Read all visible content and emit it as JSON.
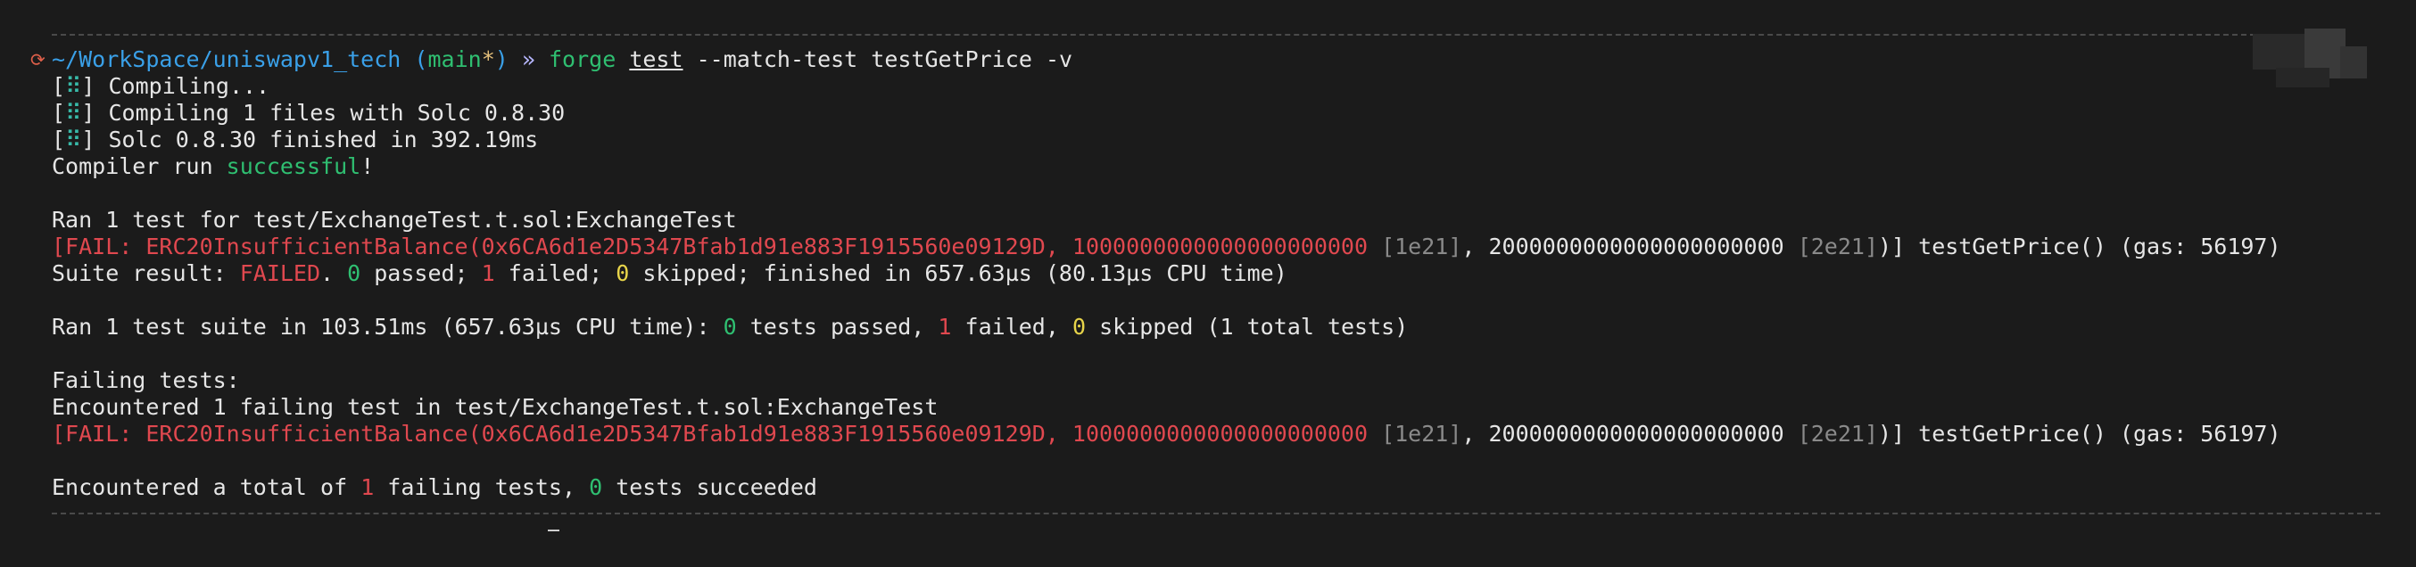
{
  "prompt": {
    "path": "~/WorkSpace/uniswapv1_tech",
    "branch_open": "(",
    "branch": "main",
    "branch_dirty": "*",
    "branch_close": ")",
    "arrow": "»",
    "command": "forge",
    "subcommand": "test",
    "args": "--match-test testGetPrice -v"
  },
  "compile": {
    "spinner": "⠿",
    "lines": [
      "Compiling...",
      "Compiling 1 files with Solc 0.8.30",
      "Solc 0.8.30 finished in 392.19ms"
    ],
    "run_prefix": "Compiler run ",
    "run_status": "successful",
    "run_suffix": "!"
  },
  "suite": {
    "ran": "Ran 1 test for test/ExchangeTest.t.sol:ExchangeTest",
    "fail_prefix": "[FAIL: ERC20InsufficientBalance(0x6CA6d1e2D5347Bfab1d91e883F1915560e09129D, 1000000000000000000000 ",
    "fail_sci1": "[1e21]",
    "fail_mid": ", 2000000000000000000000 ",
    "fail_sci2": "[2e21]",
    "fail_suffix": ")] testGetPrice() (gas: 56197)",
    "result_label": "Suite result: ",
    "result_status": "FAILED",
    "result_sep": ". ",
    "passed_count": "0",
    "passed_label": " passed; ",
    "failed_count": "1",
    "failed_label": " failed; ",
    "skipped_count": "0",
    "skipped_label": " skipped; finished in 657.63µs (80.13µs CPU time)"
  },
  "summary": {
    "prefix": "Ran 1 test suite in 103.51ms (657.63µs CPU time): ",
    "passed_count": "0",
    "passed_label": " tests passed, ",
    "failed_count": "1",
    "failed_label": " failed, ",
    "skipped_count": "0",
    "skipped_label": " skipped (1 total tests)"
  },
  "failing": {
    "header": "Failing tests:",
    "encountered": "Encountered 1 failing test in test/ExchangeTest.t.sol:ExchangeTest"
  },
  "total": {
    "prefix": "Encountered a total of ",
    "failing_count": "1",
    "middle": " failing tests, ",
    "succeeded_count": "0",
    "suffix": " tests succeeded"
  },
  "colors": {
    "background": "#1b1b1b",
    "path": "#3aa0e8",
    "green": "#2fbf71",
    "red": "#e0484f",
    "yellow": "#e7d44a",
    "dim": "#8a8a8a"
  }
}
